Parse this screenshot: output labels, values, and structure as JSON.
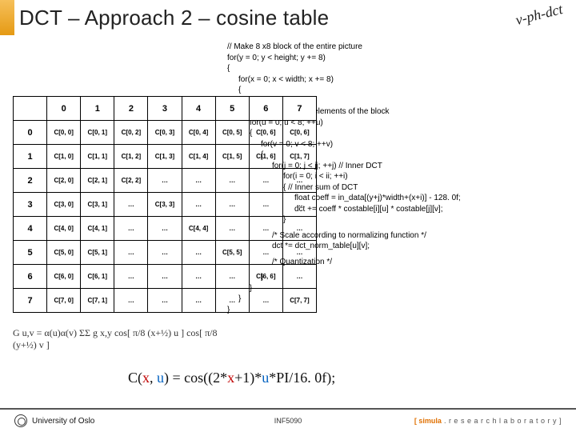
{
  "title": "DCT – Approach 2 – cosine table",
  "stamp": "v-ph-dct",
  "table": {
    "col_headers": [
      "0",
      "1",
      "2",
      "3",
      "4",
      "5",
      "6",
      "7"
    ],
    "row_headers": [
      "0",
      "1",
      "2",
      "3",
      "4",
      "5",
      "6",
      "7"
    ],
    "rows": [
      [
        "C[0, 0]",
        "C[0, 1]",
        "C[0, 2]",
        "C[0, 3]",
        "C[0, 4]",
        "C[0, 5]",
        "C[0, 6]",
        "C[0, 6]"
      ],
      [
        "C[1, 0]",
        "C[1, 1]",
        "C[1, 2]",
        "C[1, 3]",
        "C[1, 4]",
        "C[1, 5]",
        "C[1, 6]",
        "C[1, 7]"
      ],
      [
        "C[2, 0]",
        "C[2, 1]",
        "C[2, 2]",
        "…",
        "…",
        "…",
        "…",
        "…"
      ],
      [
        "C[3, 0]",
        "C[3, 1]",
        "…",
        "C[3, 3]",
        "…",
        "…",
        "…",
        "…"
      ],
      [
        "C[4, 0]",
        "C[4, 1]",
        "…",
        "…",
        "C[4, 4]",
        "…",
        "…",
        "…"
      ],
      [
        "C[5, 0]",
        "C[5, 1]",
        "…",
        "…",
        "…",
        "C[5, 5]",
        "…",
        "…"
      ],
      [
        "C[6, 0]",
        "C[6, 1]",
        "…",
        "…",
        "…",
        "…",
        "C[6, 6]",
        "…"
      ],
      [
        "C[7, 0]",
        "C[7, 1]",
        "…",
        "…",
        "…",
        "…",
        "…",
        "C[7, 7]"
      ]
    ]
  },
  "code": {
    "l01": "// Make 8 x8 block of the entire picture",
    "l02": "for(y = 0; y < height; y += 8)",
    "l03": "{",
    "l04": "for(x = 0; x < width; x += 8)",
    "l05": "{",
    "l06": "…",
    "l07": "//Loop through all elements of the block",
    "l08": "for(u = 0; u < 8; ++u)",
    "l09": "{",
    "l10": "for(v = 0; v < 8; ++v)",
    "l11": "{",
    "l12": "for(j = 0; j < jj; ++j)  // Inner DCT",
    "l13": "for(i = 0; i < ii; ++i)",
    "l14": "{  // Inner sum of DCT",
    "l15": "float coeff = in_data[(y+j)*width+(x+i)] - 128. 0f;",
    "l16": "dct += coeff * costable[i][u] * costable[j][v];",
    "l17": "}",
    "l18": "/* Scale according to normalizing function */",
    "l19": "dct *= dct_norm_table[u][v];",
    "l20": "/* Quantization */",
    "l21": "}",
    "l22": "}",
    "l23": "}",
    "l24": "}"
  },
  "formula_g": "G u,v = α(u)α(v) ΣΣ g x,y cos[ π/8 (x+½) u ] cos[ π/8 (y+½) v ]",
  "cfun": {
    "pre": "C(",
    "x": "x",
    "mid1": ", ",
    "u": "u",
    "mid2": ") = cos((2*",
    "x2": "x",
    "mid3": "+1)*",
    "u2": "u",
    "post": "*PI/16. 0f);"
  },
  "footer": {
    "uio": "University of Oslo",
    "course": "INF5090",
    "lab_s": "[ simula",
    "lab_rest": " . r e s e a r c h  l a b o r a t o r y ]"
  }
}
